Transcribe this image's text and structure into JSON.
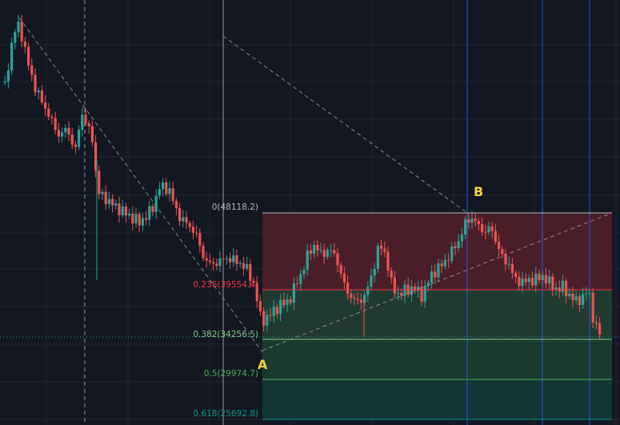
{
  "chart_data": {
    "type": "candlestick",
    "title": "",
    "grid": true,
    "colors": {
      "background": "#131722",
      "grid": "#1f2430",
      "bull": "#26a69a",
      "bear": "#ef5350",
      "vline_blue": "#2962ff",
      "vline_gray": "#9598a1",
      "trend": "#9598a1",
      "label_yellow": "#f5d443",
      "last_price_line": "#26a69a"
    },
    "fib_levels": [
      {
        "ratio": "0",
        "price": 48118.2,
        "label": "0(48118.2)",
        "line_color": "#b2b5be",
        "text_color": "#b2b5be",
        "fill": "#4a1e29"
      },
      {
        "ratio": "0.236",
        "price": 39554.4,
        "label": "0.236(39554.4)",
        "line_color": "#f23645",
        "text_color": "#f23645",
        "fill": "#213a30"
      },
      {
        "ratio": "0.382",
        "price": 34256.5,
        "label": "0.382(34256.5)",
        "line_color": "#81c784",
        "text_color": "#81c784",
        "fill": "#1a3a30"
      },
      {
        "ratio": "0.5",
        "price": 29974.7,
        "label": "0.5(29974.7)",
        "line_color": "#4caf50",
        "text_color": "#4caf50",
        "fill": "#123536"
      },
      {
        "ratio": "0.618",
        "price": 25692.8,
        "label": "0.618(25692.8)",
        "line_color": "#089981",
        "text_color": "#089981",
        "fill": "#123536"
      }
    ],
    "points": [
      {
        "name": "A",
        "label": "A"
      },
      {
        "name": "B",
        "label": "B"
      }
    ]
  }
}
